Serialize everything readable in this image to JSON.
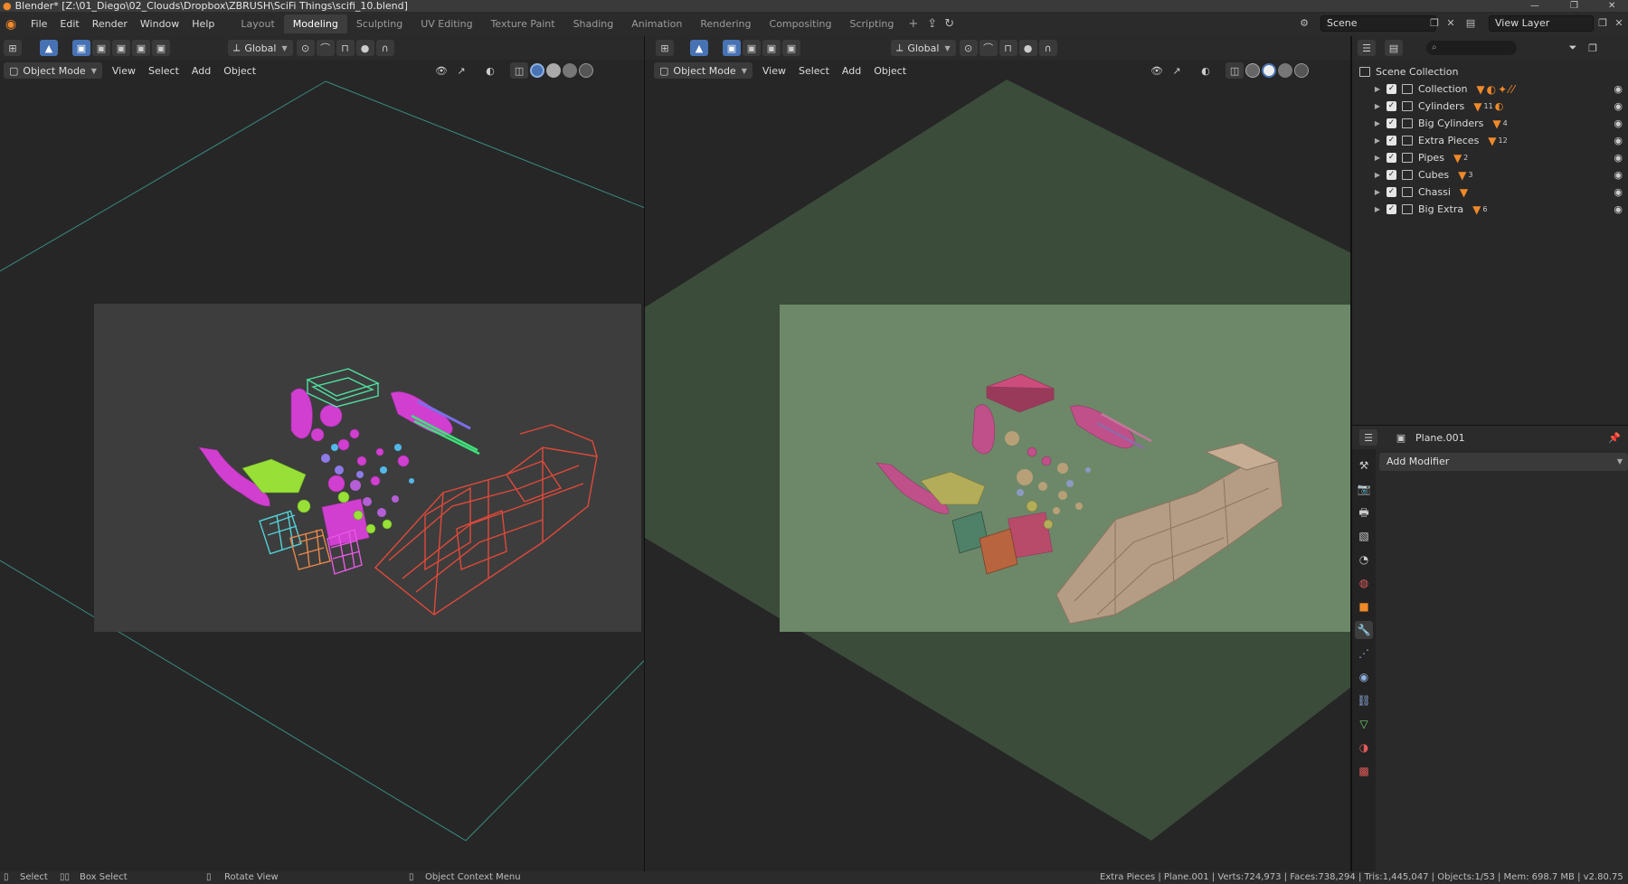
{
  "window": {
    "title": "Blender* [Z:\\01_Diego\\02_Clouds\\Dropbox\\ZBRUSH\\SciFi Things\\scifi_10.blend]"
  },
  "menu": {
    "items": [
      "File",
      "Edit",
      "Render",
      "Window",
      "Help"
    ]
  },
  "workspaces": {
    "tabs": [
      "Layout",
      "Modeling",
      "Sculpting",
      "UV Editing",
      "Texture Paint",
      "Shading",
      "Animation",
      "Rendering",
      "Compositing",
      "Scripting"
    ],
    "active": "Modeling"
  },
  "scene": {
    "label": "Scene"
  },
  "view_layer": {
    "label": "View Layer"
  },
  "viewport_left": {
    "transform": "Global",
    "mode": "Object Mode",
    "menus": [
      "View",
      "Select",
      "Add",
      "Object"
    ]
  },
  "viewport_right": {
    "transform": "Global",
    "mode": "Object Mode",
    "menus": [
      "View",
      "Select",
      "Add",
      "Object"
    ]
  },
  "outliner": {
    "root": "Scene Collection",
    "search_placeholder": "",
    "collections": [
      {
        "name": "Collection",
        "badge": ""
      },
      {
        "name": "Cylinders",
        "badge": "11"
      },
      {
        "name": "Big Cylinders",
        "badge": "4"
      },
      {
        "name": "Extra Pieces",
        "badge": "12"
      },
      {
        "name": "Pipes",
        "badge": "2"
      },
      {
        "name": "Cubes",
        "badge": "3"
      },
      {
        "name": "Chassi",
        "badge": ""
      },
      {
        "name": "Big Extra",
        "badge": "6"
      }
    ]
  },
  "properties": {
    "object_name": "Plane.001",
    "add_modifier": "Add Modifier"
  },
  "statusbar": {
    "select": "Select",
    "box_select": "Box Select",
    "rotate_view": "Rotate View",
    "context_menu": "Object Context Menu",
    "stats": "Extra Pieces | Plane.001 | Verts:724,973 | Faces:738,294 | Tris:1,445,047 | Objects:1/53 | Mem: 698.7 MB | v2.80.75"
  },
  "colors": {
    "accent": "#4772b3",
    "orange": "#f0892a",
    "wire_red": "#e0493a",
    "wire_magenta": "#d13fd0",
    "wire_green": "#5fe08c",
    "wire_cyan": "#53d2d8",
    "solid_plane": "#6f8a6b"
  }
}
